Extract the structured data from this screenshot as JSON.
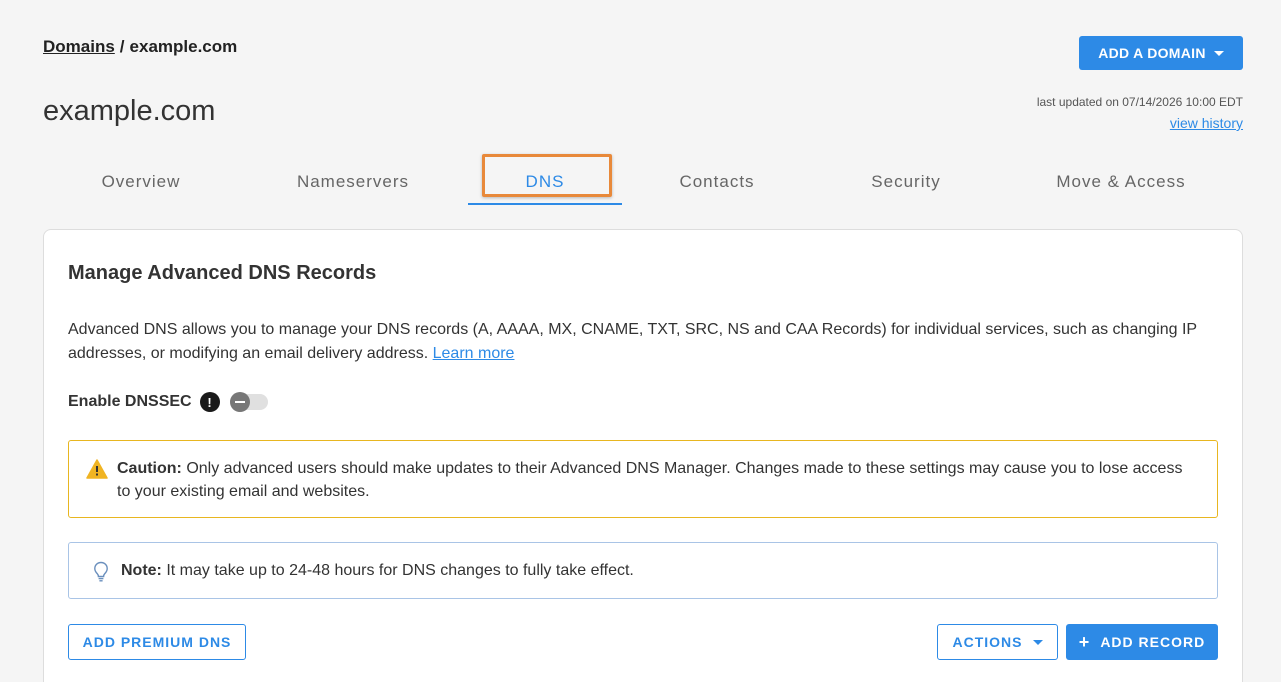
{
  "breadcrumb": {
    "root": "Domains",
    "separator": "/",
    "current": "example.com"
  },
  "header": {
    "add_domain_label": "ADD A DOMAIN",
    "page_title": "example.com",
    "last_updated": "last updated on 07/14/2026 10:00 EDT",
    "view_history": "view history"
  },
  "tabs": [
    {
      "label": "Overview"
    },
    {
      "label": "Nameservers"
    },
    {
      "label": "DNS",
      "active": true
    },
    {
      "label": "Contacts"
    },
    {
      "label": "Security"
    },
    {
      "label": "Move & Access"
    }
  ],
  "card": {
    "title": "Manage Advanced DNS Records",
    "description": "Advanced DNS allows you to manage your DNS records (A, AAAA, MX, CNAME, TXT, SRC, NS and CAA Records) for individual services, such as changing IP addresses, or modifying an email delivery address.",
    "learn_more": "Learn more",
    "dnssec_label": "Enable DNSSEC",
    "dnssec_info_glyph": "!",
    "dnssec_enabled": false,
    "caution_label": "Caution:",
    "caution_text": "Only advanced users should make updates to their Advanced DNS Manager. Changes made to these settings may cause you to lose access to your existing email and websites.",
    "note_label": "Note:",
    "note_text": "It may take up to 24-48 hours for DNS changes to fully take effect.",
    "premium_dns_label": "ADD PREMIUM DNS",
    "actions_label": "ACTIONS",
    "add_record_label": "ADD RECORD",
    "add_record_glyph": "+"
  },
  "colors": {
    "accent": "#2d8ae6",
    "tab_highlight": "#e8893a",
    "caution_border": "#e8b620",
    "caution_icon": "#f0b423",
    "note_border": "#a9c4e6"
  },
  "icons": {
    "caret": "chevron-down-icon",
    "info": "info-icon",
    "caution": "warning-icon",
    "note": "lightbulb-icon",
    "add": "plus-icon"
  }
}
